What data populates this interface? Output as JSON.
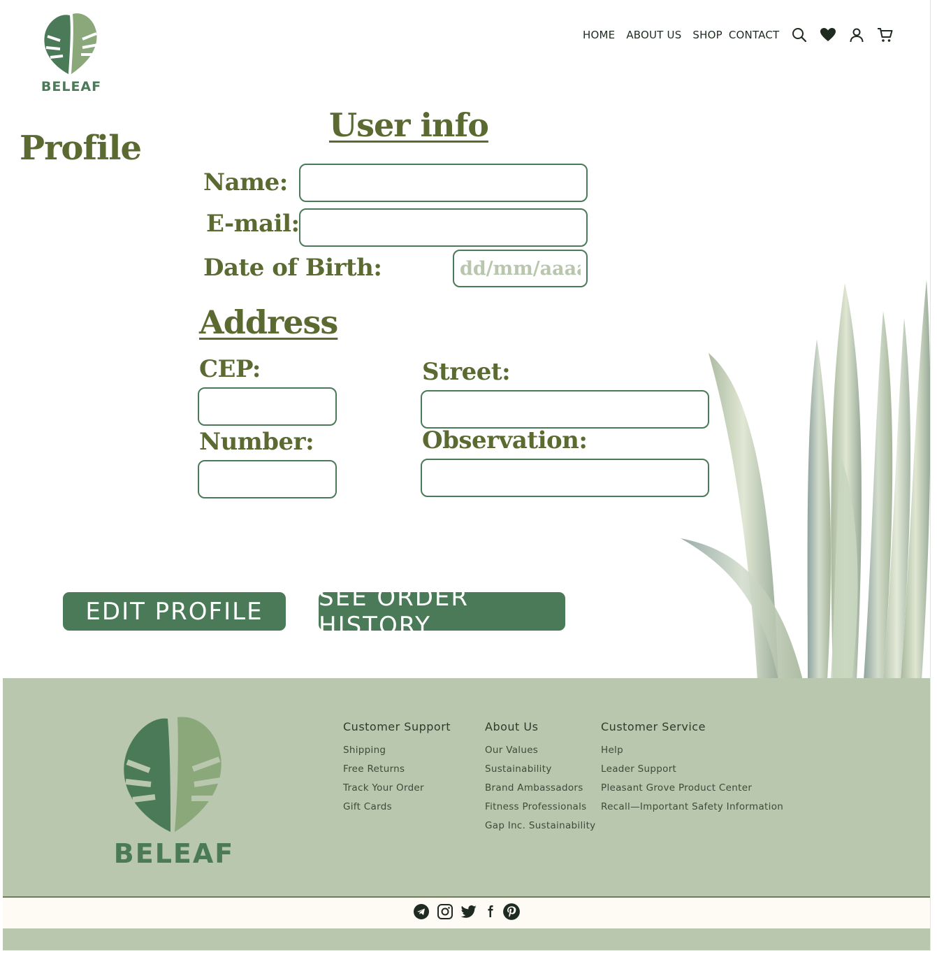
{
  "brand": {
    "name": "BELEAF",
    "accent": "#4a7a57",
    "title_color": "#5b6a31",
    "footer_bg": "#b9c7ae"
  },
  "nav": {
    "links": [
      "HOME",
      "ABOUT US",
      "SHOP",
      "CONTACT"
    ],
    "icons": [
      "search-icon",
      "heart-icon",
      "user-icon",
      "cart-icon"
    ]
  },
  "page": {
    "title": "Profile"
  },
  "user_info": {
    "heading": "User info",
    "name_label": "Name:",
    "email_label": "E-mail:",
    "dob_label": "Date of Birth:",
    "dob_placeholder": "dd/mm/aaaa"
  },
  "address": {
    "heading": "Address",
    "cep_label": "CEP:",
    "street_label": "Street:",
    "number_label": "Number:",
    "observation_label": "Observation:"
  },
  "buttons": {
    "edit_profile": "EDIT PROFILE",
    "order_history": "SEE ORDER HISTORY"
  },
  "footer": {
    "columns": [
      {
        "title": "Customer Support",
        "links": [
          "Shipping",
          "Free Returns",
          "Track Your Order",
          "Gift Cards"
        ]
      },
      {
        "title": "About Us",
        "links": [
          "Our Values",
          "Sustainability",
          "Brand Ambassadors",
          "Fitness Professionals",
          "Gap Inc. Sustainability"
        ]
      },
      {
        "title": "Customer Service",
        "links": [
          "Help",
          "Leader Support",
          "Pleasant Grove Product Center",
          "Recall—Important Safety Information"
        ]
      }
    ],
    "social_icons": [
      "telegram-icon",
      "instagram-icon",
      "twitter-icon",
      "facebook-icon",
      "pinterest-icon"
    ]
  }
}
